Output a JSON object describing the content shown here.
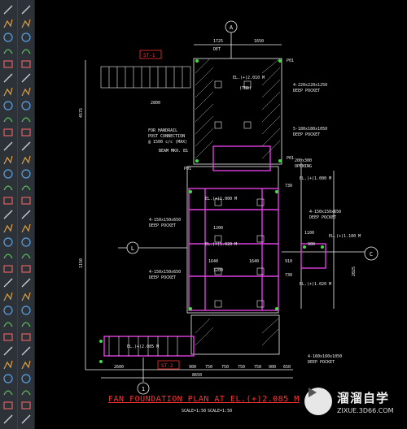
{
  "drawing": {
    "title": "FAN FOUNDATION PLAN AT EL.(+)2.085 M",
    "scale_a": "SCALE=1:50",
    "scale_b": "SCALE=1:50",
    "section_tags": [
      "ST-1",
      "ST-2"
    ],
    "grid_bubbles": [
      "A",
      "L",
      "C",
      "1"
    ],
    "dims_top": [
      "1725",
      "1650"
    ],
    "dims_bottom": [
      "2600",
      "900",
      "750",
      "750",
      "750",
      "750",
      "900",
      "650"
    ],
    "dims_bottom_total": "8650",
    "dim_left_top": "4575",
    "dim_left_mid": "1150",
    "dim_ladder": "2800",
    "labels": {
      "p01_a": "P01",
      "p01_b": "P01",
      "p01_c": "P01",
      "pocket_1": "4-220x220x1250",
      "pocket_1b": "DEEP POCKET",
      "pocket_2": "5-180x180x1050",
      "pocket_2b": "DEEP POCKET",
      "opening": "200x300",
      "opening_b": "OPENING",
      "handrail": "FOR HANDRAIL",
      "handrail_b": "POST CONNECTION",
      "handrail_c": "@ 1500 c/c (MAX)",
      "beam": "BEAM MK0. B1",
      "el_1": "EL.(+)1.000 M",
      "el_2": "EL.(+)1.020 M",
      "el_3": "EL.(+)1.000 M",
      "el_4": "EL.(+)1.020 M",
      "el_5": "EL.(+)2.010 M",
      "el_6": "EL.(+)2.085 M",
      "el_7": "EL.(+)1.100 M",
      "pocket_3": "4-150x150x650",
      "pocket_3b": "DEEP POCKET",
      "pocket_4": "4-150x150x650",
      "pocket_4b": "DEEP POCKET",
      "pocket_5": "4-160x160x1050",
      "pocket_5b": "DEEP POCKET",
      "pocket_6": "4-150x150x650",
      "pocket_6b": "DEEP POCKET",
      "dim_1200a": "1200",
      "dim_1200b": "1200",
      "dim_1640a": "1640",
      "dim_1640b": "1640",
      "det": "DET",
      "tbd": "(TBD)",
      "dims_right": [
        "1100",
        "900",
        "730",
        "910",
        "730",
        "2025"
      ]
    }
  },
  "watermark": {
    "title": "溜溜自学",
    "url": "ZIXUE.3D66.COM",
    "icon": "play-triangle-icon"
  },
  "toolbar": {
    "left_icons": [
      "line-icon",
      "polyline-icon",
      "circle-icon",
      "arc-icon",
      "rectangle-icon",
      "cloud-icon",
      "spline-icon",
      "ellipse-icon",
      "hatch-icon",
      "gradient-icon",
      "region-icon",
      "table-icon",
      "point-icon",
      "block-icon",
      "insert-icon",
      "text-icon",
      "mtext-icon",
      "dimension-icon",
      "leader-icon",
      "qleader-icon",
      "align-icon",
      "chain-icon",
      "move-icon",
      "copy-icon",
      "rotate-icon",
      "mirror-icon",
      "offset-icon",
      "array-icon",
      "scale-icon",
      "stretch-icon",
      "trim-icon"
    ],
    "right_icons": [
      "erase-icon",
      "copy-icon",
      "mirror-icon",
      "offset-icon",
      "array-icon",
      "move-icon",
      "rotate-icon",
      "scale-icon",
      "stretch-icon",
      "trim-icon",
      "extend-icon",
      "break-icon",
      "join-icon",
      "chamfer-icon",
      "fillet-icon",
      "blend-icon",
      "explode-icon",
      "pedit-icon",
      "matchprop-icon",
      "layer-icon",
      "properties-icon",
      "dist-icon",
      "area-icon",
      "list-icon",
      "id-icon",
      "zoom-icon",
      "pan-icon",
      "orbit-icon",
      "snap-icon",
      "grid-icon",
      "ortho-icon"
    ]
  }
}
